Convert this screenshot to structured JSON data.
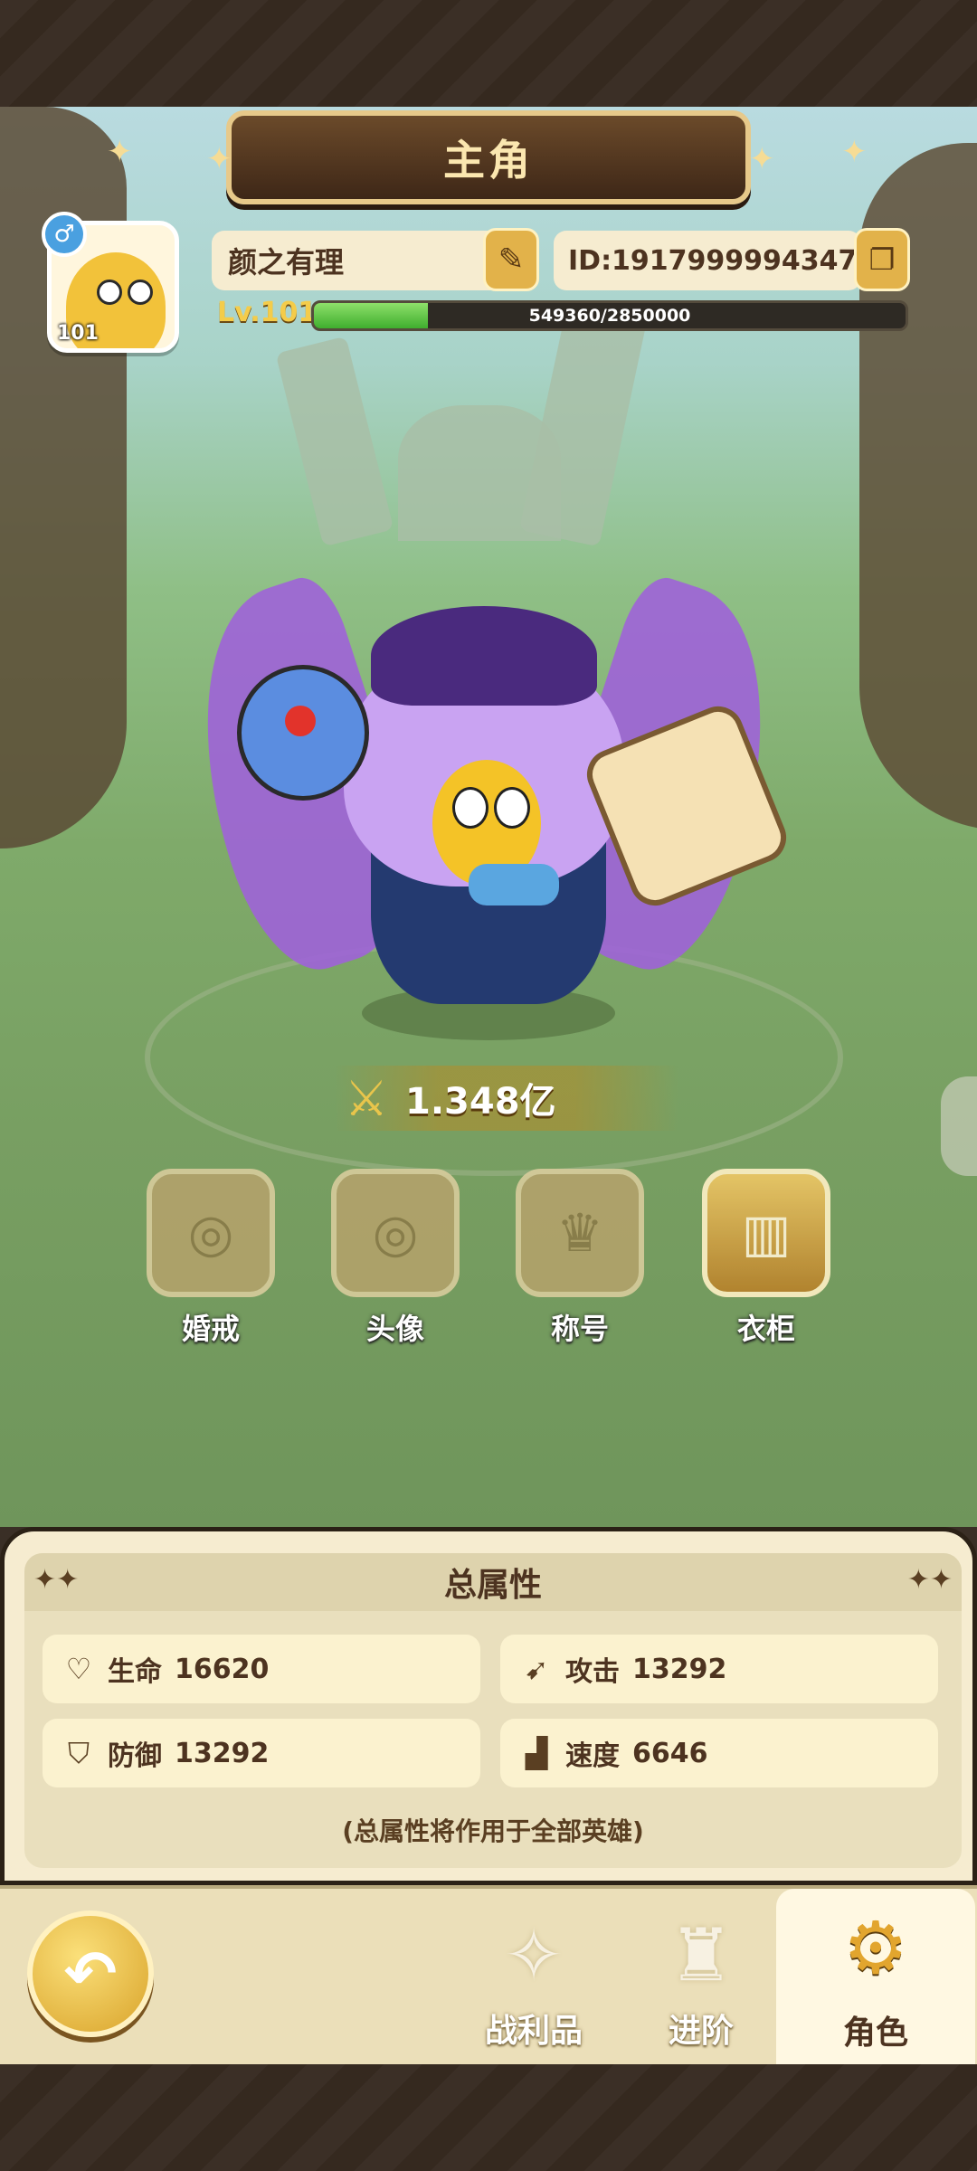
{
  "header": {
    "title": "主角"
  },
  "profile": {
    "level_badge": "101",
    "gender_symbol": "♂",
    "name": "颜之有理",
    "id_text": "ID:1917999994347",
    "level_label": "Lv.101",
    "exp_text": "549360/2850000",
    "exp_fraction": 0.1928
  },
  "power": {
    "value": "1.348亿"
  },
  "features": [
    {
      "label": "婚戒"
    },
    {
      "label": "头像"
    },
    {
      "label": "称号"
    },
    {
      "label": "衣柜"
    }
  ],
  "attributes": {
    "title": "总属性",
    "stats": [
      {
        "name": "生命",
        "value": "16620",
        "icon": "heart-icon"
      },
      {
        "name": "攻击",
        "value": "13292",
        "icon": "attack-icon"
      },
      {
        "name": "防御",
        "value": "13292",
        "icon": "shield-icon"
      },
      {
        "name": "速度",
        "value": "6646",
        "icon": "boot-icon"
      }
    ],
    "note": "(总属性将作用于全部英雄)"
  },
  "nav": {
    "items": [
      {
        "label": "战利品",
        "icon": "loot-icon"
      },
      {
        "label": "进阶",
        "icon": "advance-icon"
      },
      {
        "label": "角色",
        "icon": "character-icon"
      }
    ]
  }
}
